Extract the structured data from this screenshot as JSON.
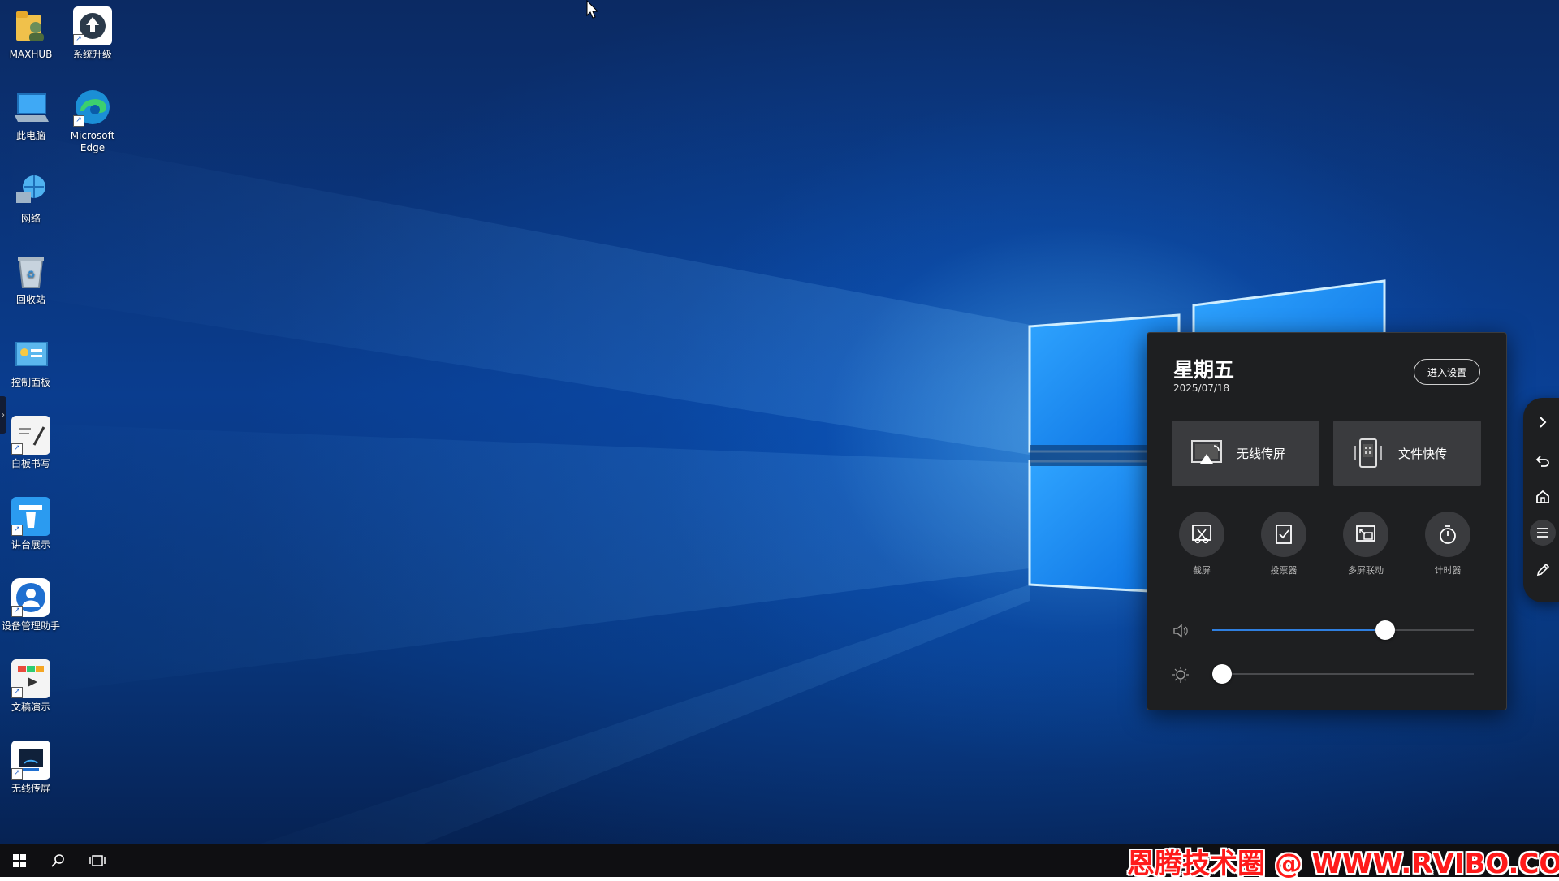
{
  "desktop": {
    "icons": [
      {
        "label": "MAXHUB",
        "icon": "user-folder-icon"
      },
      {
        "label": "系统升级",
        "icon": "upgrade-icon"
      },
      {
        "label": "此电脑",
        "icon": "computer-icon"
      },
      {
        "label": "Microsoft Edge",
        "icon": "edge-icon"
      },
      {
        "label": "网络",
        "icon": "network-icon"
      },
      {
        "label": "回收站",
        "icon": "recycle-bin-icon"
      },
      {
        "label": "控制面板",
        "icon": "control-panel-icon"
      },
      {
        "label": "白板书写",
        "icon": "whiteboard-icon"
      },
      {
        "label": "讲台展示",
        "icon": "podium-display-icon"
      },
      {
        "label": "设备管理助手",
        "icon": "device-manager-icon"
      },
      {
        "label": "文稿演示",
        "icon": "presentation-icon"
      },
      {
        "label": "无线传屏",
        "icon": "wireless-cast-icon"
      }
    ]
  },
  "panel": {
    "weekday": "星期五",
    "date": "2025/07/18",
    "settings_label": "进入设置",
    "big_buttons": [
      {
        "label": "无线传屏",
        "icon": "screen-cast-icon"
      },
      {
        "label": "文件快传",
        "icon": "file-transfer-icon"
      }
    ],
    "tools": [
      {
        "label": "截屏",
        "icon": "screenshot-icon"
      },
      {
        "label": "投票器",
        "icon": "vote-icon"
      },
      {
        "label": "多屏联动",
        "icon": "multi-screen-icon"
      },
      {
        "label": "计时器",
        "icon": "timer-icon"
      }
    ],
    "volume": {
      "level": 0.66,
      "icon": "speaker-icon"
    },
    "brightness": {
      "level": 0.03,
      "icon": "brightness-icon"
    }
  },
  "side_toolbar": {
    "buttons": [
      "chevron-right-icon",
      "back-icon",
      "home-icon",
      "menu-icon",
      "pen-icon"
    ]
  },
  "taskbar": {
    "buttons": [
      "windows-start-icon",
      "search-icon",
      "task-view-icon"
    ]
  },
  "watermark": "恩腾技术圈 @ WWW.RVIBO.COM",
  "colors": {
    "accent": "#2f7fe0",
    "panel_bg": "#1e1f21",
    "button_bg": "#3a3b3e",
    "watermark": "#ff1a1a"
  }
}
